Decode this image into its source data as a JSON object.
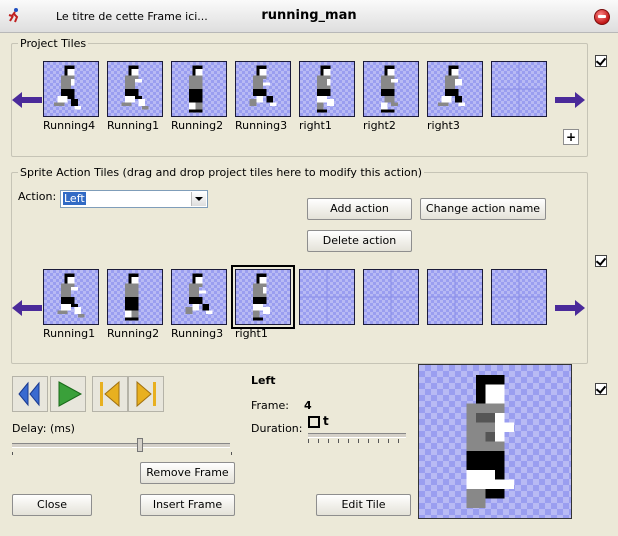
{
  "window": {
    "title_left": "Le titre de cette Frame ici...",
    "title": "running_man",
    "app_icon": "running-man-icon",
    "close_icon": "close-icon"
  },
  "project_tiles": {
    "group_label": "Project Tiles",
    "items": [
      {
        "label": "Running4",
        "pose": "run-a"
      },
      {
        "label": "Running1",
        "pose": "run-b"
      },
      {
        "label": "Running2",
        "pose": "stand"
      },
      {
        "label": "Running3",
        "pose": "run-c"
      },
      {
        "label": "right1",
        "pose": "right-a"
      },
      {
        "label": "right2",
        "pose": "right-b"
      },
      {
        "label": "right3",
        "pose": "right-c"
      },
      {
        "label": "",
        "pose": "empty"
      }
    ],
    "add_label": "+"
  },
  "sprite_action": {
    "group_label": "Sprite Action Tiles (drag and drop project tiles here to modify this action)",
    "action_label": "Action:",
    "action_value": "Left",
    "add_action": "Add action",
    "change_action_name": "Change action name",
    "delete_action": "Delete action",
    "items": [
      {
        "label": "Running1",
        "pose": "run-b"
      },
      {
        "label": "Running2",
        "pose": "stand"
      },
      {
        "label": "Running3",
        "pose": "run-c"
      },
      {
        "label": "right1",
        "pose": "right-a"
      },
      {
        "label": "",
        "pose": "empty"
      },
      {
        "label": "",
        "pose": "empty"
      },
      {
        "label": "",
        "pose": "empty"
      },
      {
        "label": "",
        "pose": "empty"
      }
    ],
    "selected_index": 3
  },
  "playback": {
    "delay_label": "Delay: (ms)",
    "remove_frame": "Remove Frame",
    "insert_frame": "Insert Frame",
    "close": "Close",
    "edit_tile": "Edit Tile"
  },
  "frame_info": {
    "action_name": "Left",
    "frame_label": "Frame:",
    "frame_value": "4",
    "duration_label": "Duration:",
    "duration_value": "t"
  },
  "checkboxes": {
    "project": true,
    "sprite": true,
    "preview": true
  },
  "colors": {
    "tile_bg": "#b8baf4",
    "arrow": "#4a2a9a",
    "play": "#3aa03a",
    "rewind": "#3a6ad0",
    "frame_ctl": "#e8b020"
  }
}
